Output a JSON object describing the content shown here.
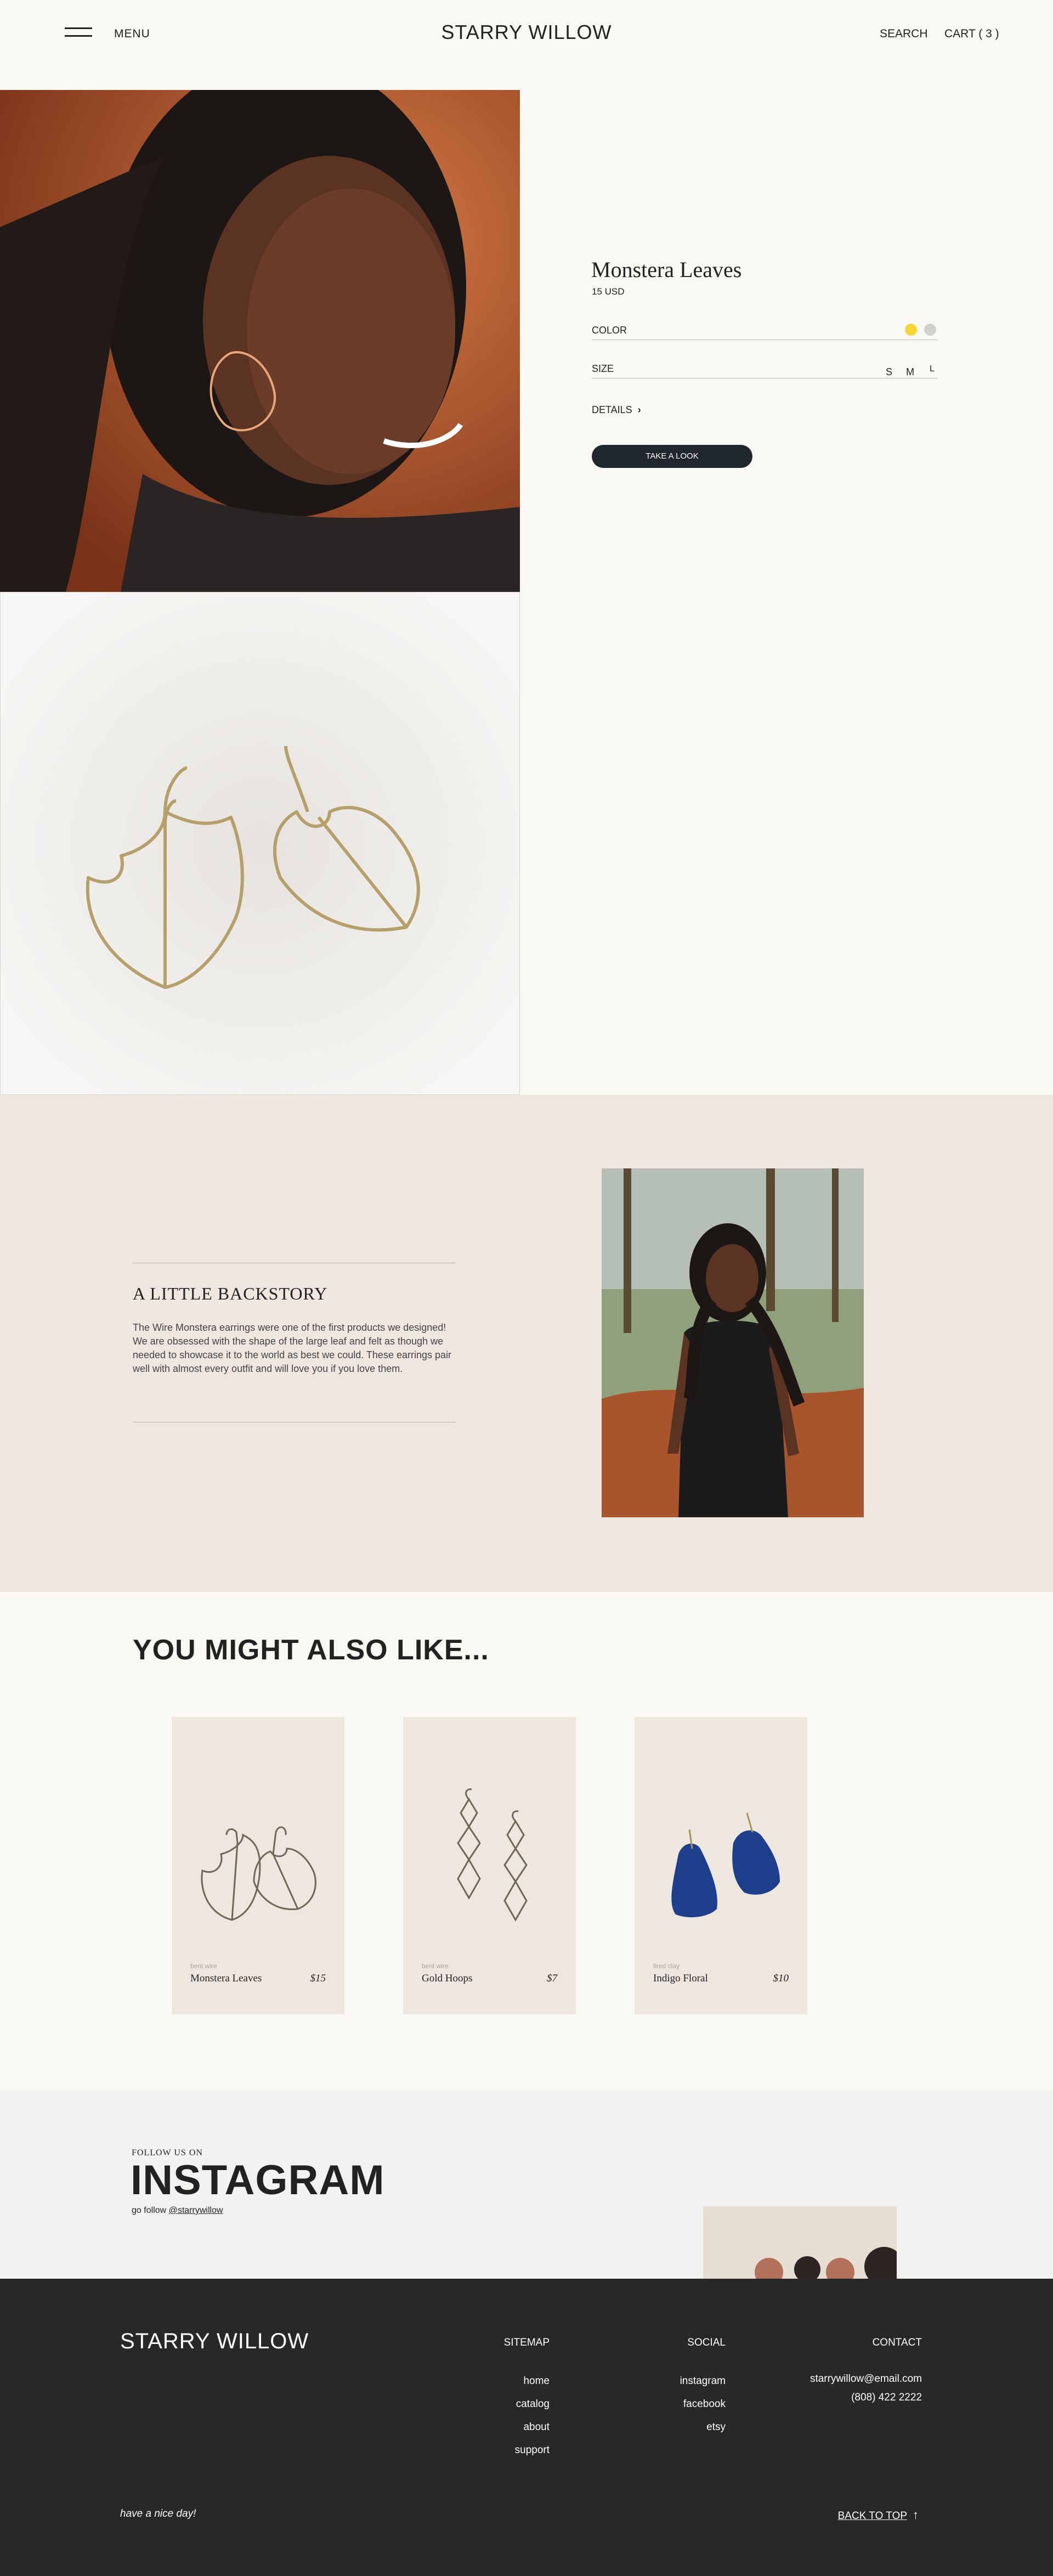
{
  "header": {
    "menu_label": "MENU",
    "brand": "STARRY WILLOW",
    "search_label": "SEARCH",
    "cart_label": "CART ( 3 )"
  },
  "product": {
    "title": "Monstera Leaves",
    "price": "15 USD",
    "color_label": "COLOR",
    "colors": [
      "#f6d735",
      "#d3d1cc"
    ],
    "size_label": "SIZE",
    "sizes": [
      "S",
      "M",
      "L"
    ],
    "details_label": "DETAILS",
    "cta_label": "TAKE A LOOK"
  },
  "backstory": {
    "title": "A LITTLE BACKSTORY",
    "text": "The Wire Monstera earrings were one of the first products we designed! We are obsessed with the shape of the large leaf and felt as though we needed to showcase it to the world as best we could. These earrings pair well with almost every outfit and will love you if you love them."
  },
  "also_like": {
    "title": "YOU MIGHT ALSO LIKE...",
    "items": [
      {
        "sub": "bent wire",
        "name": "Monstera Leaves",
        "price": "$15"
      },
      {
        "sub": "bent wire",
        "name": "Gold Hoops",
        "price": "$7"
      },
      {
        "sub": "fired clay",
        "name": "Indigo Floral",
        "price": "$10"
      }
    ]
  },
  "instagram": {
    "kicker": "FOLLOW US ON",
    "title": "INSTAGRAM",
    "follow_prefix": "go follow",
    "handle": "@starrywillow"
  },
  "footer": {
    "brand": "STARRY WILLOW",
    "sitemap_heading": "SITEMAP",
    "sitemap_links": [
      "home",
      "catalog",
      "about",
      "support"
    ],
    "social_heading": "SOCIAL",
    "social_links": [
      "instagram",
      "facebook",
      "etsy"
    ],
    "contact_heading": "CONTACT",
    "contact_email": "starrywillow@email.com",
    "contact_phone": "(808) 422 2222",
    "tagline": "have a nice day!",
    "back_to_top": "BACK TO TOP"
  }
}
